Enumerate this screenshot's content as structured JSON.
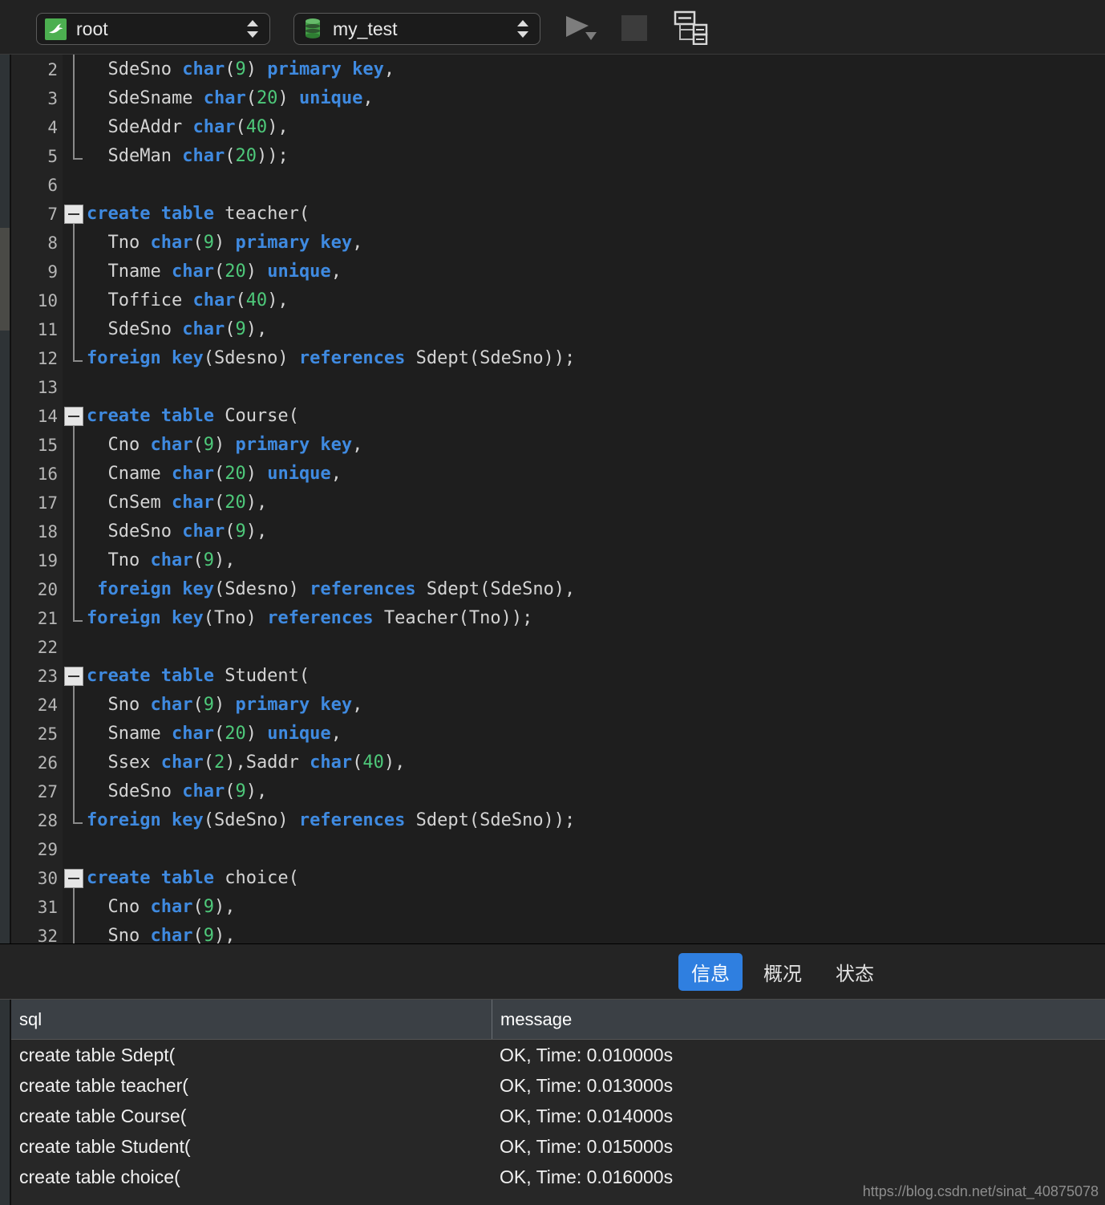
{
  "toolbar": {
    "user_combo": {
      "value": "root",
      "icon": "mysql-dolphin-icon"
    },
    "db_combo": {
      "value": "my_test",
      "icon": "database-icon"
    },
    "run_button_icon": "run-play-icon",
    "stop_button_icon": "stop-square-icon",
    "explain_button_icon": "explain-plan-icon"
  },
  "editor": {
    "first_visible_line": 2,
    "lines": [
      {
        "n": 2,
        "fold": "body",
        "tokens": [
          {
            "t": "  SdeSno ",
            "c": "pl"
          },
          {
            "t": "char",
            "c": "kw"
          },
          {
            "t": "(",
            "c": "pl"
          },
          {
            "t": "9",
            "c": "num"
          },
          {
            "t": ") ",
            "c": "pl"
          },
          {
            "t": "primary key",
            "c": "kw"
          },
          {
            "t": ",",
            "c": "pl"
          }
        ]
      },
      {
        "n": 3,
        "fold": "body",
        "tokens": [
          {
            "t": "  SdeSname ",
            "c": "pl"
          },
          {
            "t": "char",
            "c": "kw"
          },
          {
            "t": "(",
            "c": "pl"
          },
          {
            "t": "20",
            "c": "num"
          },
          {
            "t": ") ",
            "c": "pl"
          },
          {
            "t": "unique",
            "c": "kw"
          },
          {
            "t": ",",
            "c": "pl"
          }
        ]
      },
      {
        "n": 4,
        "fold": "body",
        "tokens": [
          {
            "t": "  SdeAddr ",
            "c": "pl"
          },
          {
            "t": "char",
            "c": "kw"
          },
          {
            "t": "(",
            "c": "pl"
          },
          {
            "t": "40",
            "c": "num"
          },
          {
            "t": "),",
            "c": "pl"
          }
        ]
      },
      {
        "n": 5,
        "fold": "end",
        "tokens": [
          {
            "t": "  SdeMan ",
            "c": "pl"
          },
          {
            "t": "char",
            "c": "kw"
          },
          {
            "t": "(",
            "c": "pl"
          },
          {
            "t": "20",
            "c": "num"
          },
          {
            "t": "));",
            "c": "pl"
          }
        ]
      },
      {
        "n": 6,
        "fold": "none",
        "tokens": []
      },
      {
        "n": 7,
        "fold": "start",
        "tokens": [
          {
            "t": "create table",
            "c": "kw"
          },
          {
            "t": " teacher(",
            "c": "pl"
          }
        ]
      },
      {
        "n": 8,
        "fold": "body",
        "tokens": [
          {
            "t": "  Tno ",
            "c": "pl"
          },
          {
            "t": "char",
            "c": "kw"
          },
          {
            "t": "(",
            "c": "pl"
          },
          {
            "t": "9",
            "c": "num"
          },
          {
            "t": ") ",
            "c": "pl"
          },
          {
            "t": "primary key",
            "c": "kw"
          },
          {
            "t": ",",
            "c": "pl"
          }
        ]
      },
      {
        "n": 9,
        "fold": "body",
        "tokens": [
          {
            "t": "  Tname ",
            "c": "pl"
          },
          {
            "t": "char",
            "c": "kw"
          },
          {
            "t": "(",
            "c": "pl"
          },
          {
            "t": "20",
            "c": "num"
          },
          {
            "t": ") ",
            "c": "pl"
          },
          {
            "t": "unique",
            "c": "kw"
          },
          {
            "t": ",",
            "c": "pl"
          }
        ]
      },
      {
        "n": 10,
        "fold": "body",
        "tokens": [
          {
            "t": "  Toffice ",
            "c": "pl"
          },
          {
            "t": "char",
            "c": "kw"
          },
          {
            "t": "(",
            "c": "pl"
          },
          {
            "t": "40",
            "c": "num"
          },
          {
            "t": "),",
            "c": "pl"
          }
        ]
      },
      {
        "n": 11,
        "fold": "body",
        "tokens": [
          {
            "t": "  SdeSno ",
            "c": "pl"
          },
          {
            "t": "char",
            "c": "kw"
          },
          {
            "t": "(",
            "c": "pl"
          },
          {
            "t": "9",
            "c": "num"
          },
          {
            "t": "),",
            "c": "pl"
          }
        ]
      },
      {
        "n": 12,
        "fold": "end",
        "tokens": [
          {
            "t": "foreign key",
            "c": "kw"
          },
          {
            "t": "(Sdesno) ",
            "c": "pl"
          },
          {
            "t": "references",
            "c": "kw"
          },
          {
            "t": " Sdept(SdeSno));",
            "c": "pl"
          }
        ]
      },
      {
        "n": 13,
        "fold": "none",
        "tokens": []
      },
      {
        "n": 14,
        "fold": "start",
        "tokens": [
          {
            "t": "create table",
            "c": "kw"
          },
          {
            "t": " Course(",
            "c": "pl"
          }
        ]
      },
      {
        "n": 15,
        "fold": "body",
        "tokens": [
          {
            "t": "  Cno ",
            "c": "pl"
          },
          {
            "t": "char",
            "c": "kw"
          },
          {
            "t": "(",
            "c": "pl"
          },
          {
            "t": "9",
            "c": "num"
          },
          {
            "t": ") ",
            "c": "pl"
          },
          {
            "t": "primary key",
            "c": "kw"
          },
          {
            "t": ",",
            "c": "pl"
          }
        ]
      },
      {
        "n": 16,
        "fold": "body",
        "tokens": [
          {
            "t": "  Cname ",
            "c": "pl"
          },
          {
            "t": "char",
            "c": "kw"
          },
          {
            "t": "(",
            "c": "pl"
          },
          {
            "t": "20",
            "c": "num"
          },
          {
            "t": ") ",
            "c": "pl"
          },
          {
            "t": "unique",
            "c": "kw"
          },
          {
            "t": ",",
            "c": "pl"
          }
        ]
      },
      {
        "n": 17,
        "fold": "body",
        "tokens": [
          {
            "t": "  CnSem ",
            "c": "pl"
          },
          {
            "t": "char",
            "c": "kw"
          },
          {
            "t": "(",
            "c": "pl"
          },
          {
            "t": "20",
            "c": "num"
          },
          {
            "t": "),",
            "c": "pl"
          }
        ]
      },
      {
        "n": 18,
        "fold": "body",
        "tokens": [
          {
            "t": "  SdeSno ",
            "c": "pl"
          },
          {
            "t": "char",
            "c": "kw"
          },
          {
            "t": "(",
            "c": "pl"
          },
          {
            "t": "9",
            "c": "num"
          },
          {
            "t": "),",
            "c": "pl"
          }
        ]
      },
      {
        "n": 19,
        "fold": "body",
        "tokens": [
          {
            "t": "  Tno ",
            "c": "pl"
          },
          {
            "t": "char",
            "c": "kw"
          },
          {
            "t": "(",
            "c": "pl"
          },
          {
            "t": "9",
            "c": "num"
          },
          {
            "t": "),",
            "c": "pl"
          }
        ]
      },
      {
        "n": 20,
        "fold": "body",
        "tokens": [
          {
            "t": " ",
            "c": "pl"
          },
          {
            "t": "foreign key",
            "c": "kw"
          },
          {
            "t": "(Sdesno) ",
            "c": "pl"
          },
          {
            "t": "references",
            "c": "kw"
          },
          {
            "t": " Sdept(SdeSno),",
            "c": "pl"
          }
        ]
      },
      {
        "n": 21,
        "fold": "end",
        "tokens": [
          {
            "t": "foreign key",
            "c": "kw"
          },
          {
            "t": "(Tno) ",
            "c": "pl"
          },
          {
            "t": "references",
            "c": "kw"
          },
          {
            "t": " Teacher(Tno));",
            "c": "pl"
          }
        ]
      },
      {
        "n": 22,
        "fold": "none",
        "tokens": []
      },
      {
        "n": 23,
        "fold": "start",
        "tokens": [
          {
            "t": "create table",
            "c": "kw"
          },
          {
            "t": " Student(",
            "c": "pl"
          }
        ]
      },
      {
        "n": 24,
        "fold": "body",
        "tokens": [
          {
            "t": "  Sno ",
            "c": "pl"
          },
          {
            "t": "char",
            "c": "kw"
          },
          {
            "t": "(",
            "c": "pl"
          },
          {
            "t": "9",
            "c": "num"
          },
          {
            "t": ") ",
            "c": "pl"
          },
          {
            "t": "primary key",
            "c": "kw"
          },
          {
            "t": ",",
            "c": "pl"
          }
        ]
      },
      {
        "n": 25,
        "fold": "body",
        "tokens": [
          {
            "t": "  Sname ",
            "c": "pl"
          },
          {
            "t": "char",
            "c": "kw"
          },
          {
            "t": "(",
            "c": "pl"
          },
          {
            "t": "20",
            "c": "num"
          },
          {
            "t": ") ",
            "c": "pl"
          },
          {
            "t": "unique",
            "c": "kw"
          },
          {
            "t": ",",
            "c": "pl"
          }
        ]
      },
      {
        "n": 26,
        "fold": "body",
        "tokens": [
          {
            "t": "  Ssex ",
            "c": "pl"
          },
          {
            "t": "char",
            "c": "kw"
          },
          {
            "t": "(",
            "c": "pl"
          },
          {
            "t": "2",
            "c": "num"
          },
          {
            "t": "),Saddr ",
            "c": "pl"
          },
          {
            "t": "char",
            "c": "kw"
          },
          {
            "t": "(",
            "c": "pl"
          },
          {
            "t": "40",
            "c": "num"
          },
          {
            "t": "),",
            "c": "pl"
          }
        ]
      },
      {
        "n": 27,
        "fold": "body",
        "tokens": [
          {
            "t": "  SdeSno ",
            "c": "pl"
          },
          {
            "t": "char",
            "c": "kw"
          },
          {
            "t": "(",
            "c": "pl"
          },
          {
            "t": "9",
            "c": "num"
          },
          {
            "t": "),",
            "c": "pl"
          }
        ]
      },
      {
        "n": 28,
        "fold": "end",
        "tokens": [
          {
            "t": "foreign key",
            "c": "kw"
          },
          {
            "t": "(SdeSno) ",
            "c": "pl"
          },
          {
            "t": "references",
            "c": "kw"
          },
          {
            "t": " Sdept(SdeSno));",
            "c": "pl"
          }
        ]
      },
      {
        "n": 29,
        "fold": "none",
        "tokens": []
      },
      {
        "n": 30,
        "fold": "start",
        "tokens": [
          {
            "t": "create table",
            "c": "kw"
          },
          {
            "t": " choice(",
            "c": "pl"
          }
        ]
      },
      {
        "n": 31,
        "fold": "body",
        "tokens": [
          {
            "t": "  Cno ",
            "c": "pl"
          },
          {
            "t": "char",
            "c": "kw"
          },
          {
            "t": "(",
            "c": "pl"
          },
          {
            "t": "9",
            "c": "num"
          },
          {
            "t": "),",
            "c": "pl"
          }
        ]
      },
      {
        "n": 32,
        "fold": "body",
        "tokens": [
          {
            "t": "  Sno ",
            "c": "pl"
          },
          {
            "t": "char",
            "c": "kw"
          },
          {
            "t": "(",
            "c": "pl"
          },
          {
            "t": "9",
            "c": "num"
          },
          {
            "t": "),",
            "c": "pl"
          }
        ]
      }
    ]
  },
  "results": {
    "tabs": [
      {
        "label": "信息",
        "active": true
      },
      {
        "label": "概况",
        "active": false
      },
      {
        "label": "状态",
        "active": false
      }
    ],
    "columns": [
      "sql",
      "message"
    ],
    "rows": [
      {
        "sql": "create table Sdept(",
        "message": "OK, Time: 0.010000s"
      },
      {
        "sql": "create table teacher(",
        "message": "OK, Time: 0.013000s"
      },
      {
        "sql": "create table Course(",
        "message": "OK, Time: 0.014000s"
      },
      {
        "sql": "create table Student(",
        "message": "OK, Time: 0.015000s"
      },
      {
        "sql": "create table choice(",
        "message": "OK, Time: 0.016000s"
      }
    ]
  },
  "watermark": "https://blog.csdn.net/sinat_40875078",
  "colors": {
    "accent": "#2f7fe0",
    "keyword": "#3f8ae0",
    "number": "#4ec97a",
    "editor_bg": "#1e1e1e",
    "toolbar_bg": "#222222",
    "grid_header_bg": "#3b4045",
    "brand_green": "#4caf50"
  }
}
